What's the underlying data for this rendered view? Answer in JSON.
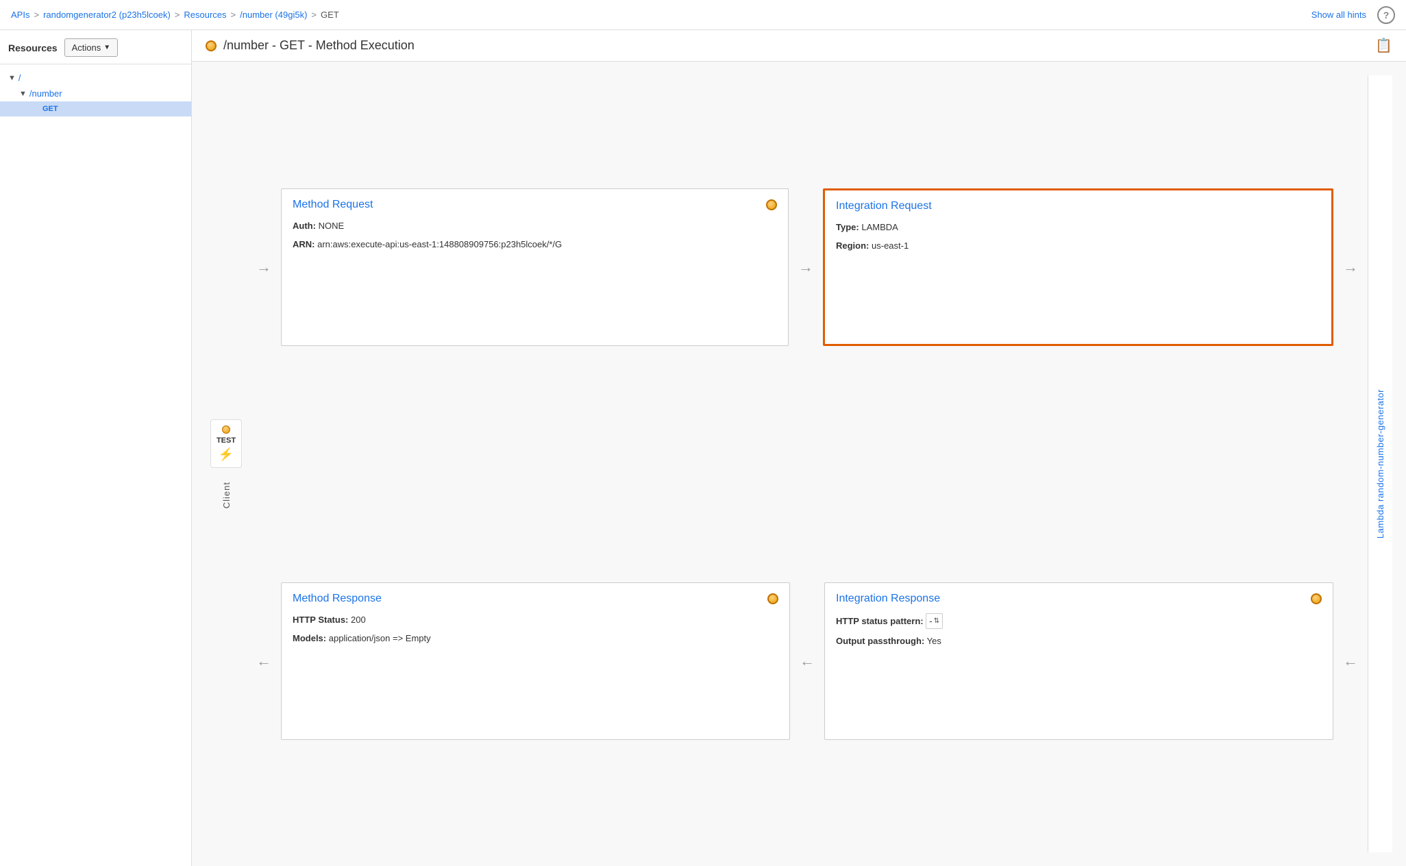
{
  "breadcrumb": {
    "items": [
      "APIs",
      "randomgenerator2 (p23h5lcoek)",
      "Resources",
      "/number (49gi5k)",
      "GET"
    ],
    "separators": [
      ">",
      ">",
      ">",
      ">"
    ]
  },
  "topbar": {
    "show_hints": "Show all hints",
    "help_icon": "?"
  },
  "sidebar": {
    "title": "Resources",
    "actions_button": "Actions",
    "tree": [
      {
        "label": "/",
        "level": "root",
        "caret": "▼"
      },
      {
        "label": "/number",
        "level": "child",
        "caret": "▼"
      },
      {
        "label": "GET",
        "level": "grandchild",
        "caret": ""
      }
    ]
  },
  "content_header": {
    "title": "/number - GET - Method Execution"
  },
  "method_request": {
    "title": "Method Request",
    "auth_label": "Auth:",
    "auth_value": "NONE",
    "arn_label": "ARN:",
    "arn_value": "arn:aws:execute-api:us-east-1:148808909756:p23h5lcoek/*/G"
  },
  "integration_request": {
    "title": "Integration Request",
    "type_label": "Type:",
    "type_value": "LAMBDA",
    "region_label": "Region:",
    "region_value": "us-east-1"
  },
  "method_response": {
    "title": "Method Response",
    "http_status_label": "HTTP Status:",
    "http_status_value": "200",
    "models_label": "Models:",
    "models_value": "application/json => Empty"
  },
  "integration_response": {
    "title": "Integration Response",
    "http_status_label": "HTTP status pattern:",
    "http_status_value": "-",
    "output_label": "Output passthrough:",
    "output_value": "Yes"
  },
  "lambda_sidebar": {
    "label": "Lambda random-number-generator"
  },
  "client": {
    "label": "Client",
    "test_label": "TEST"
  },
  "arrows": {
    "right": "→",
    "left": "←"
  }
}
